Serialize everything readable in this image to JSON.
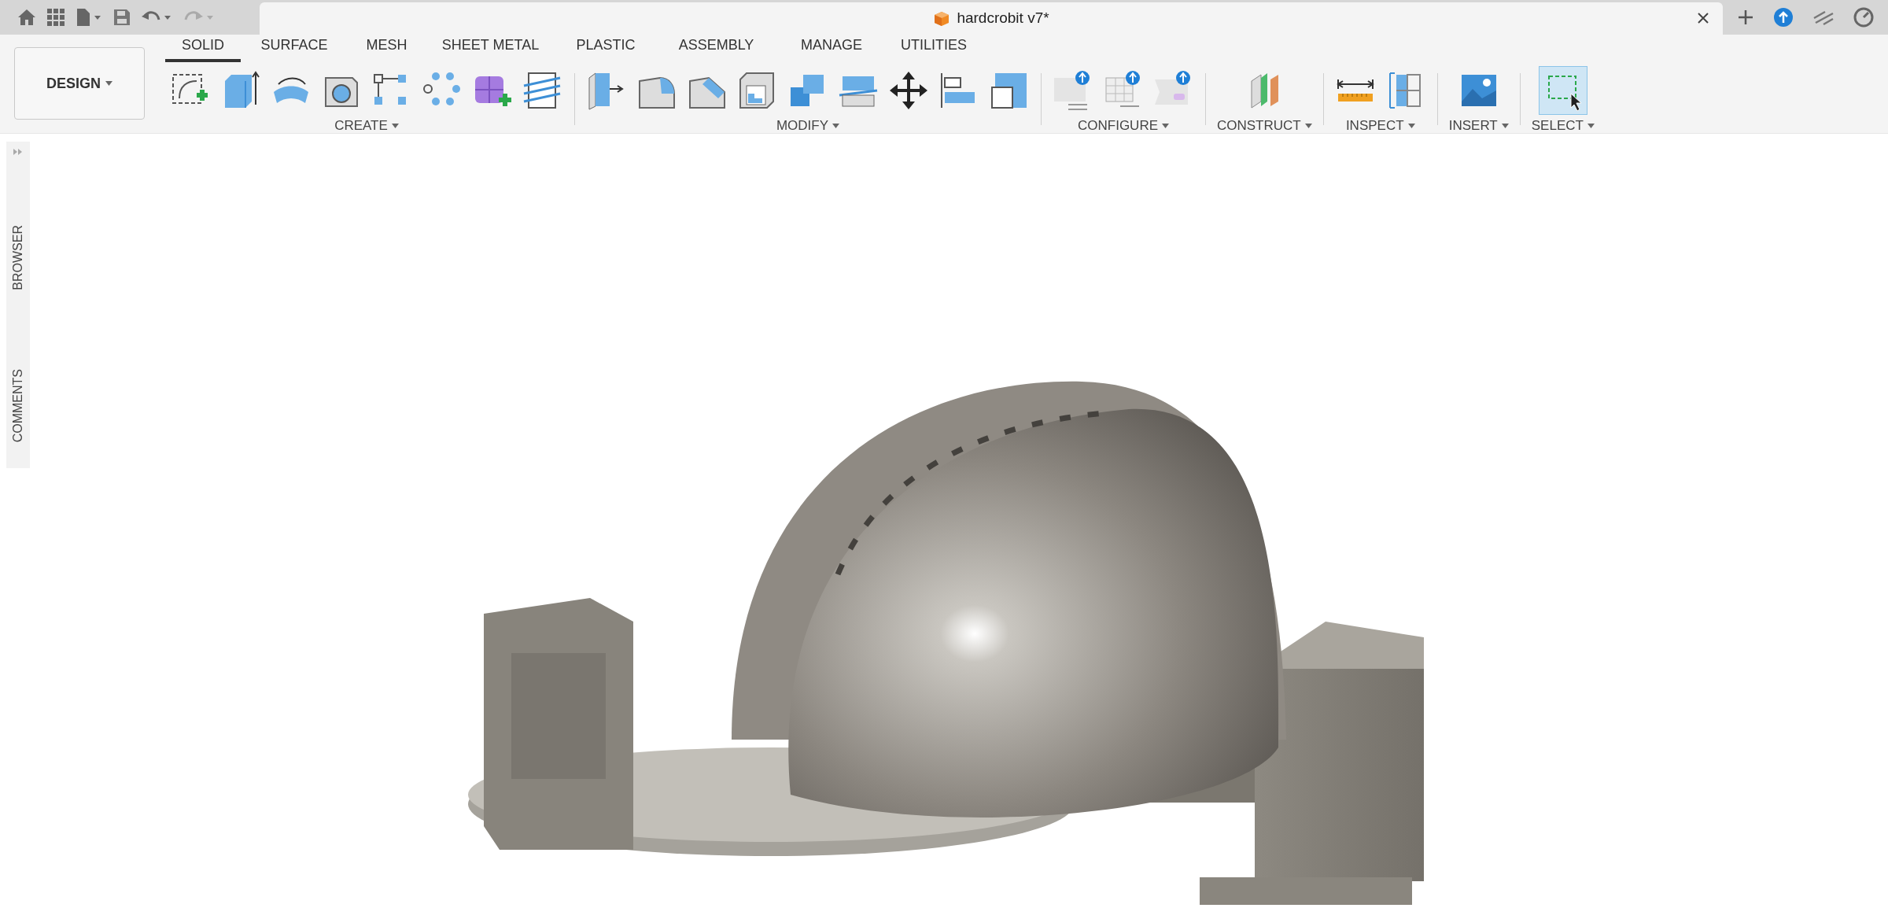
{
  "document_tab": {
    "title": "hardcrobit v7*"
  },
  "workspace": {
    "label": "DESIGN"
  },
  "tabs": [
    {
      "label": "SOLID",
      "selected": true
    },
    {
      "label": "SURFACE",
      "selected": false
    },
    {
      "label": "MESH",
      "selected": false
    },
    {
      "label": "SHEET METAL",
      "selected": false
    },
    {
      "label": "PLASTIC",
      "selected": false
    },
    {
      "label": "ASSEMBLY",
      "selected": false
    },
    {
      "label": "MANAGE",
      "selected": false
    },
    {
      "label": "UTILITIES",
      "selected": false
    }
  ],
  "groups": [
    {
      "label": "CREATE"
    },
    {
      "label": "MODIFY"
    },
    {
      "label": "CONFIGURE"
    },
    {
      "label": "CONSTRUCT"
    },
    {
      "label": "INSPECT"
    },
    {
      "label": "INSERT"
    },
    {
      "label": "SELECT"
    }
  ],
  "side_panel": [
    {
      "label": "BROWSER"
    },
    {
      "label": "COMMENTS"
    }
  ]
}
